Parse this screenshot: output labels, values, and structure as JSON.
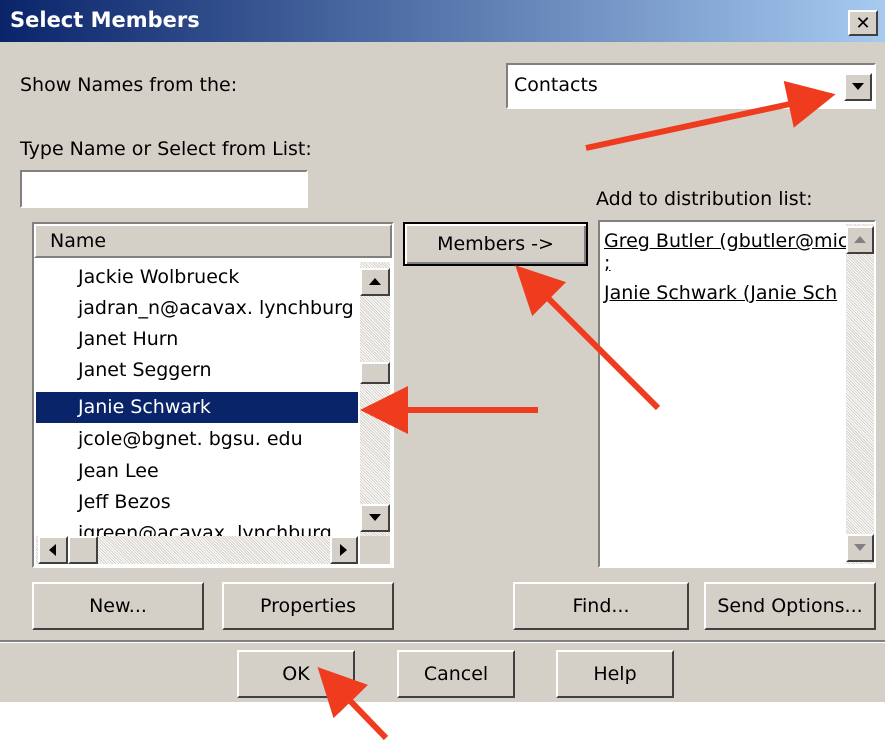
{
  "dialog": {
    "title": "Select Members",
    "close_label": "✕"
  },
  "show_names": {
    "label": "Show Names from the:",
    "value": "Contacts"
  },
  "type_name": {
    "label": "Type Name or Select from List:",
    "value": ""
  },
  "name_list": {
    "header": "Name",
    "items": [
      "Jackie Wolbrueck",
      "jadran_n@acavax. lynchburg",
      "Janet Hurn",
      "Janet Seggern",
      "Janie Schwark",
      "jcole@bgnet. bgsu. edu",
      "Jean Lee",
      "Jeff Bezos",
      "jgreen@acavax. lynchburg"
    ],
    "selected": "Janie Schwark"
  },
  "members_button": "Members ->",
  "distribution": {
    "label": "Add to distribution list:",
    "entries": [
      "Greg Butler (gbutler@mic",
      ";",
      "Janie Schwark (Janie Sch"
    ]
  },
  "buttons": {
    "new": "New...",
    "properties": "Properties",
    "find": "Find...",
    "send_options": "Send Options...",
    "ok": "OK",
    "cancel": "Cancel",
    "help": "Help"
  },
  "colors": {
    "dialog_bg": "#d4d0c8",
    "title_start": "#0a246a",
    "title_end": "#a6caf0",
    "selection": "#0a246a",
    "annotation_arrow": "#f03c1e"
  }
}
